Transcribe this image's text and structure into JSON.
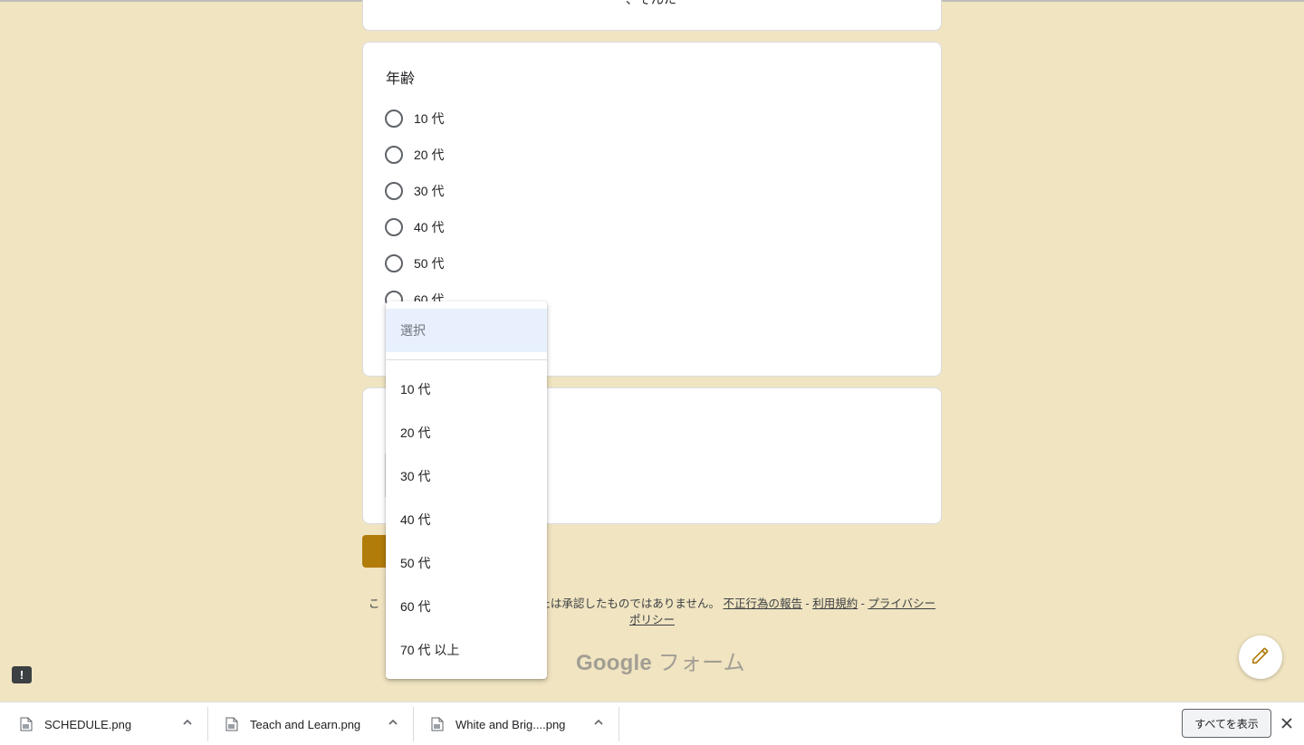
{
  "prev_card": {
    "partial_text": "、そんた"
  },
  "age_question": {
    "title": "年齢",
    "options": [
      "10 代",
      "20 代",
      "30 代",
      "40 代",
      "50 代",
      "60 代"
    ]
  },
  "dropdown": {
    "placeholder": "選択",
    "items": [
      "10 代",
      "20 代",
      "30 代",
      "40 代",
      "50 代",
      "60 代",
      "70 代 以上"
    ]
  },
  "footer": {
    "prefix": "こ",
    "text": "たは承認したものではありません。",
    "report_link": "不正行為の報告",
    "terms_link": "利用規約",
    "privacy_link": "プライバシー ポリシー",
    "sep": "-"
  },
  "brand": {
    "google": "Google",
    "forms": "フォーム"
  },
  "downloads": {
    "files": [
      "SCHEDULE.png",
      "Teach and Learn.png",
      "White and Brig....png"
    ],
    "show_all": "すべてを表示"
  },
  "colors": {
    "background": "#f0e4c1",
    "accent": "#b17c09",
    "dropdown_highlight": "#e8f0fe"
  },
  "icons": {
    "radio": "radio-unchecked-icon",
    "edit": "pencil-icon",
    "report": "report-icon",
    "file": "image-file-icon",
    "chevron": "chevron-up-icon",
    "close": "close-icon"
  }
}
